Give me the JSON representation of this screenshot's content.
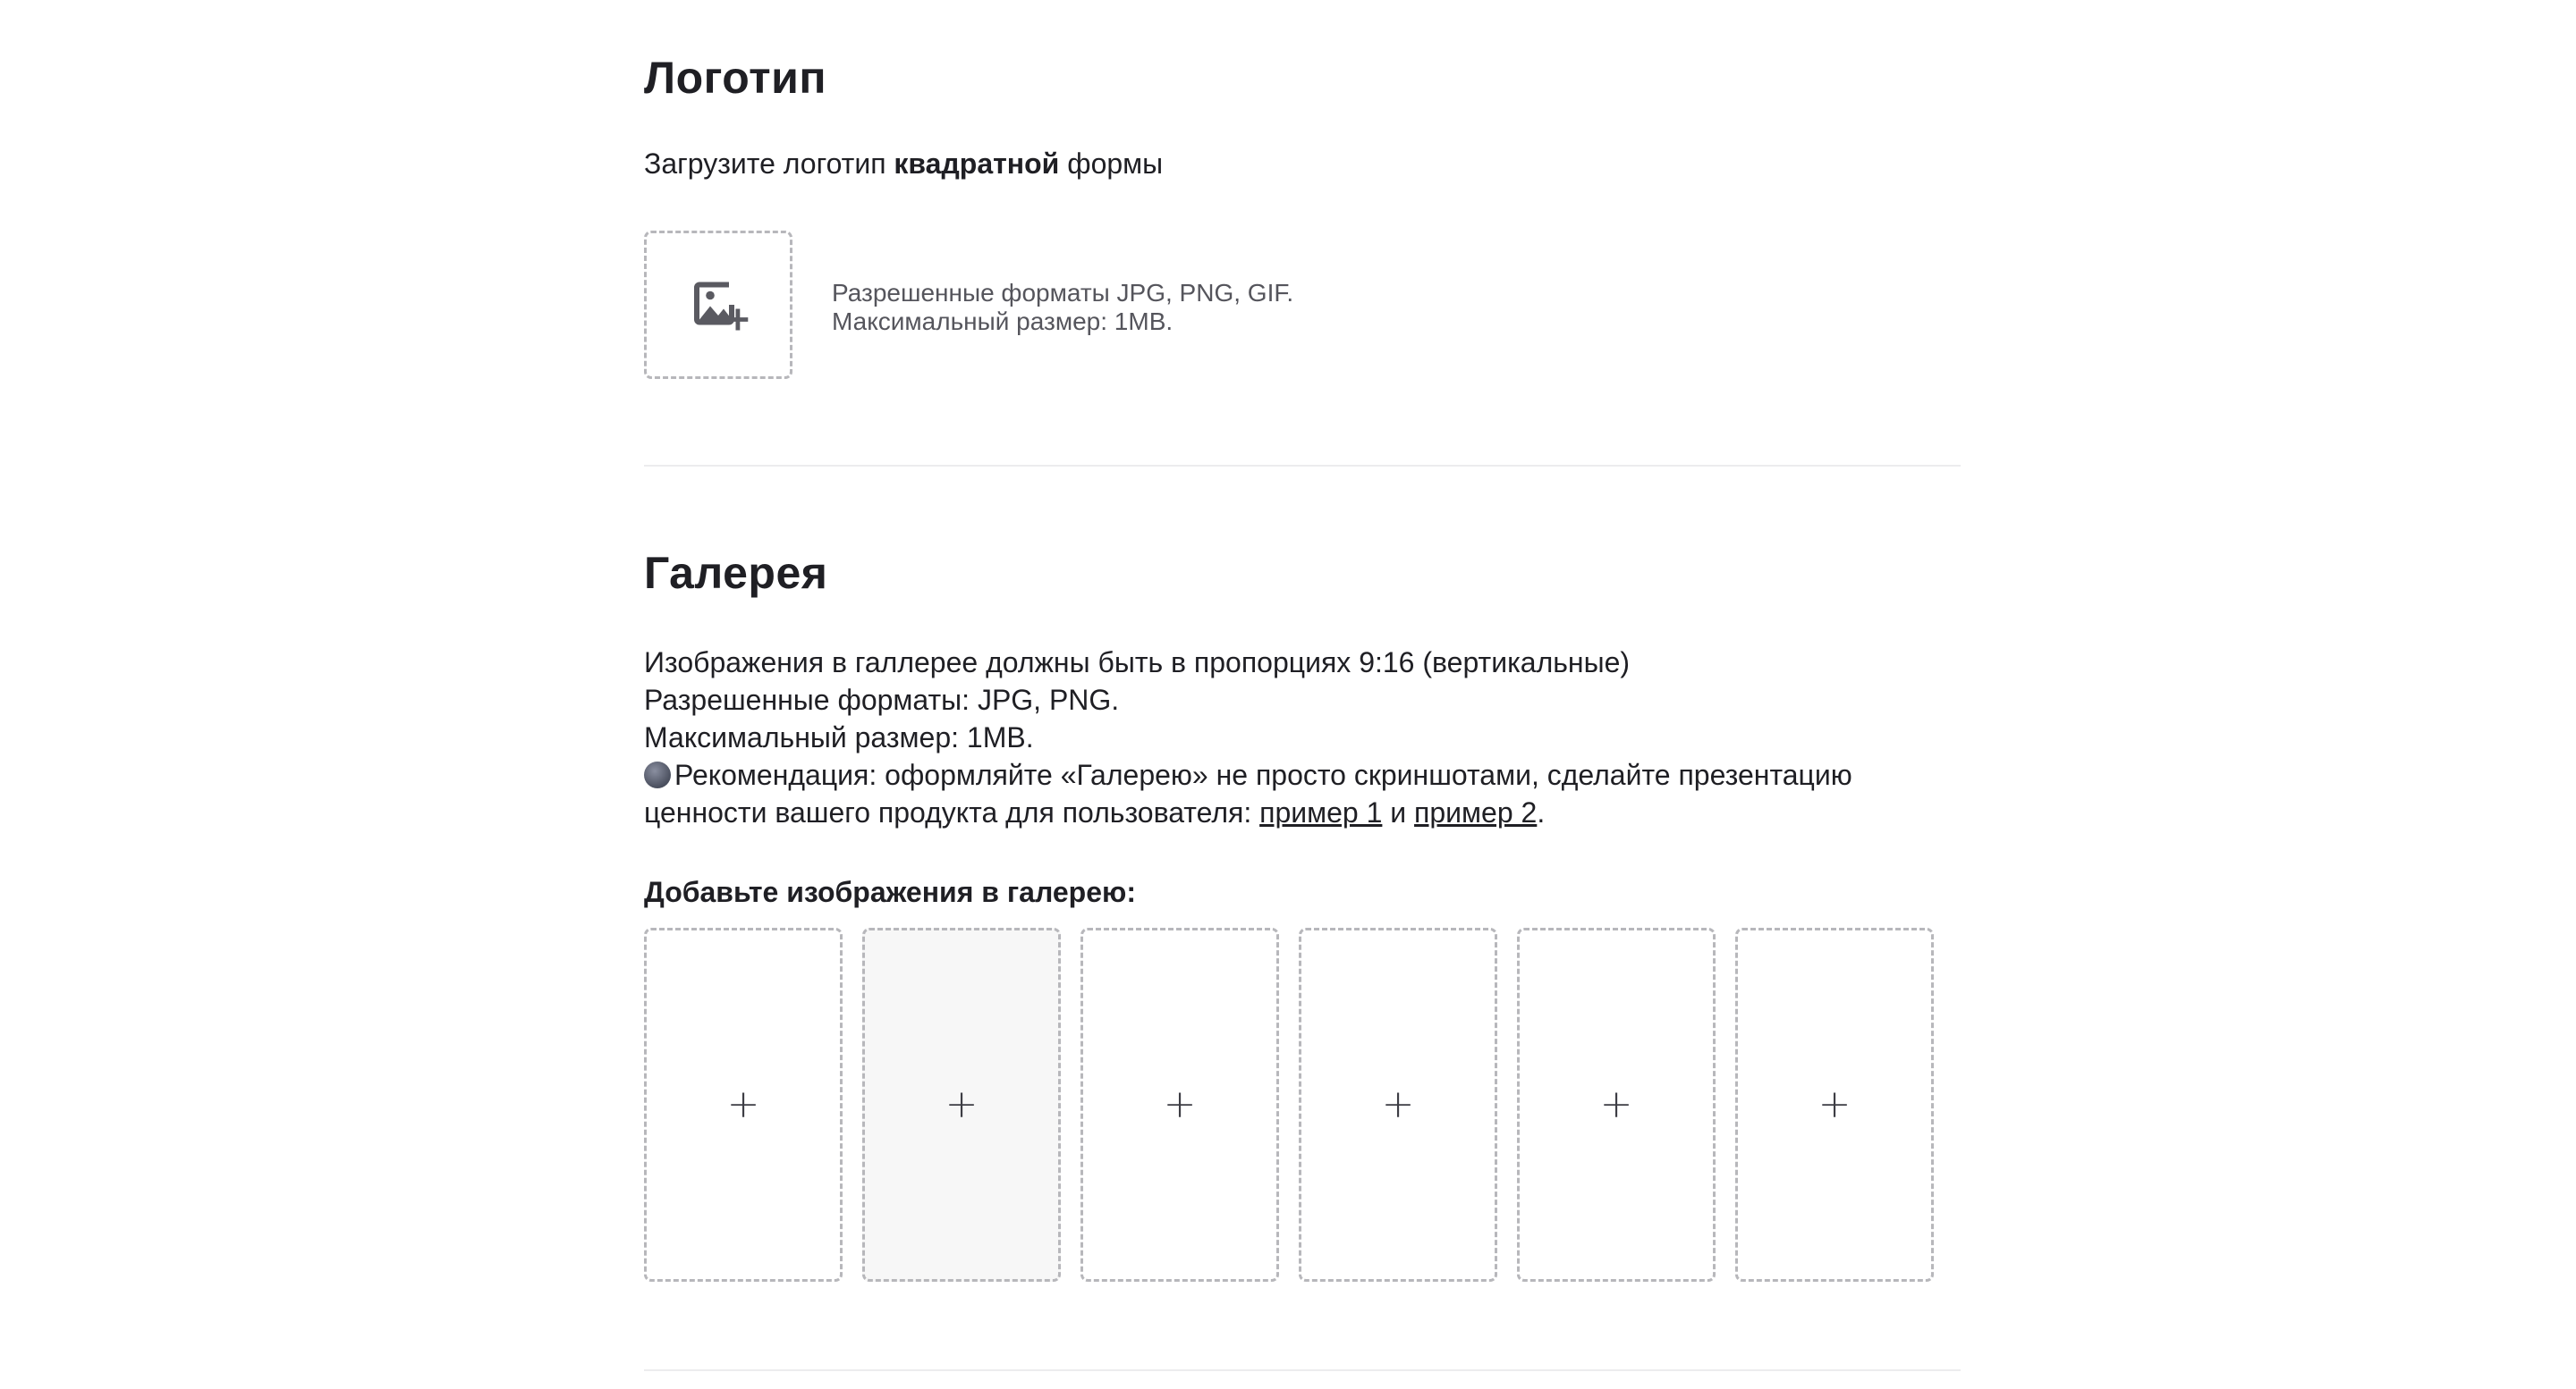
{
  "logo": {
    "title": "Логотип",
    "subtitle_before": "Загрузите логотип ",
    "subtitle_bold": "квадратной",
    "subtitle_after": " формы",
    "upload_icon": "image-add-icon",
    "hint_line1": "Разрешенные форматы JPG, PNG, GIF.",
    "hint_line2": "Максимальный размер: 1MB."
  },
  "gallery": {
    "title": "Галерея",
    "desc_line1": "Изображения в галлерее должны быть в пропорциях 9:16 (вертикальные)",
    "desc_line2": "Разрешенные форматы: JPG, PNG.",
    "desc_line3": "Максимальный размер: 1MB.",
    "rec_icon": "advice-icon",
    "rec_text": "Рекомендация: оформляйте «Галерею» не просто скриншотами, сделайте презентацию",
    "rec_text2": "ценности вашего продукта для пользователя: ",
    "link1": "пример 1",
    "link_join": " и ",
    "link2": "пример 2",
    "link_end": ".",
    "add_label": "Добавьте изображения в галерею:",
    "slots": [
      {
        "symbol": "+"
      },
      {
        "symbol": "+"
      },
      {
        "symbol": "+"
      },
      {
        "symbol": "+"
      },
      {
        "symbol": "+"
      },
      {
        "symbol": "+"
      }
    ]
  },
  "colors": {
    "text": "#1f1f24",
    "hint": "#55555c",
    "dashed_border": "#b7b7bb",
    "slot_hover_bg": "#f7f7f7",
    "divider": "#ececee"
  }
}
